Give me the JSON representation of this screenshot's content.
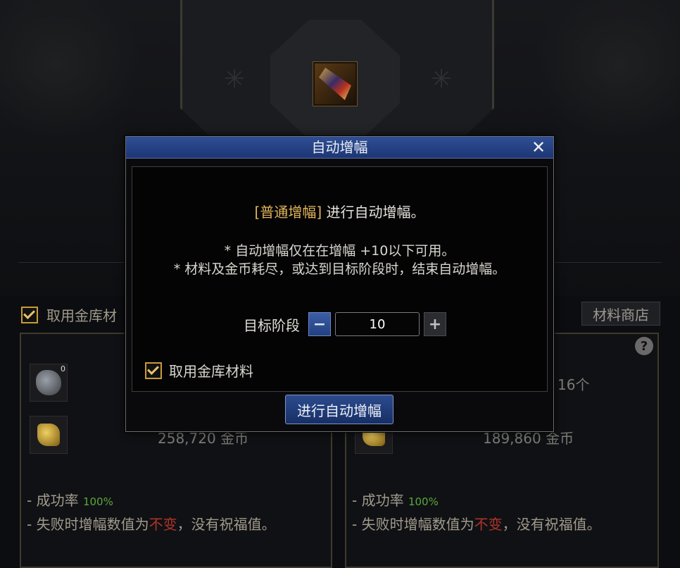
{
  "background": {
    "checkbox_label": "取用金库材",
    "shop_button": "材料商店",
    "left_panel": {
      "slot_count": "0",
      "gold_amount": "258,720",
      "gold_unit": "金币",
      "success_prefix": "- 成功率",
      "success_value": "100%",
      "fail_prefix": "- 失败时增幅数值为",
      "fail_highlight": "不变",
      "fail_suffix": "，没有祝福值。"
    },
    "right_panel": {
      "count_text": "16个",
      "gold_amount": "189,860",
      "gold_unit": "金币",
      "success_prefix": "- 成功率",
      "success_value": "100%",
      "fail_prefix": "- 失败时增幅数值为",
      "fail_highlight": "不变",
      "fail_suffix": "，没有祝福值。",
      "help_symbol": "?"
    }
  },
  "dialog": {
    "title": "自动增幅",
    "close_symbol": "✕",
    "headline_tag": "[普通增幅]",
    "headline_text": " 进行自动增幅。",
    "note_1": "* 自动增幅仅在在增幅 +10以下可用。",
    "note_2": "* 材料及金币耗尽，或达到目标阶段时，结束自动增幅。",
    "stage_label": "目标阶段",
    "minus_symbol": "−",
    "plus_symbol": "+",
    "stage_value": "10",
    "checkbox_label": "取用金库材料",
    "run_button": "进行自动增幅"
  }
}
